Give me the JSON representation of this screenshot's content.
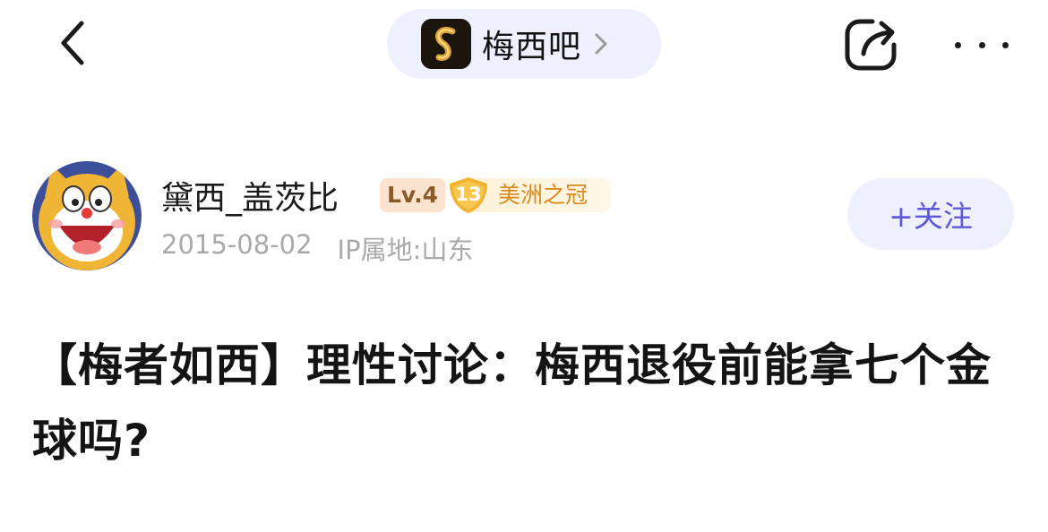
{
  "nav": {
    "back_icon": "chevron-left-icon",
    "forum_name": "梅西吧",
    "share_icon": "share-icon",
    "more_icon": "more-dots-icon"
  },
  "author": {
    "name": "黛西_盖茨比",
    "level": "Lv.4",
    "title_badge_number": "13",
    "title_badge_text": "美洲之冠",
    "date": "2015-08-02",
    "ip_location": "IP属地:山东",
    "follow_label": "+关注"
  },
  "post": {
    "title": "【梅者如西】理性讨论：梅西退役前能拿七个金球吗?"
  },
  "colors": {
    "accent": "#5e59d9",
    "pill_bg": "#eef0fd",
    "badge_gold": "#f2b430",
    "meta_text": "#a9a9a9"
  }
}
